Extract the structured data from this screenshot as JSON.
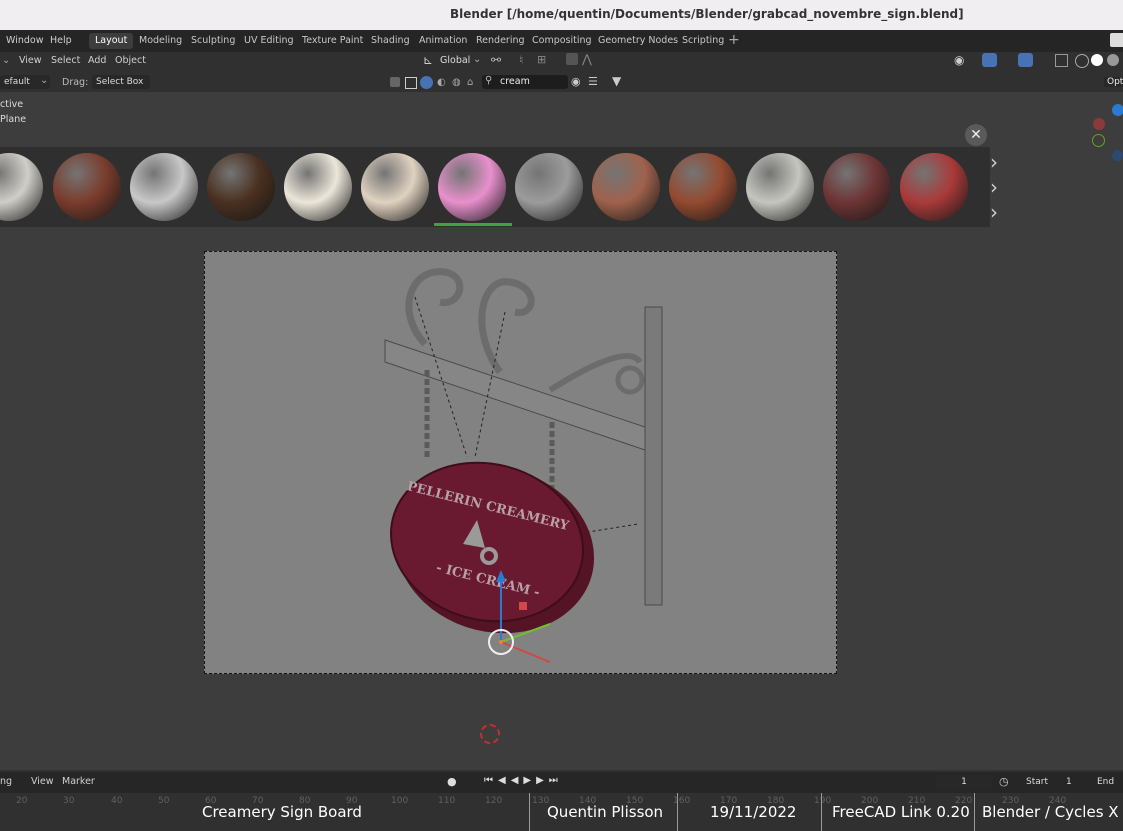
{
  "window": {
    "title": "Blender [/home/quentin/Documents/Blender/grabcad_novembre_sign.blend]"
  },
  "menu": [
    "Window",
    "Help"
  ],
  "workspace_tabs": [
    {
      "label": "Layout",
      "active": true
    },
    {
      "label": "Modeling"
    },
    {
      "label": "Sculpting"
    },
    {
      "label": "UV Editing"
    },
    {
      "label": "Texture Paint"
    },
    {
      "label": "Shading"
    },
    {
      "label": "Animation"
    },
    {
      "label": "Rendering"
    },
    {
      "label": "Compositing"
    },
    {
      "label": "Geometry Nodes"
    },
    {
      "label": "Scripting"
    }
  ],
  "viewport_menu": [
    "View",
    "Select",
    "Add",
    "Object"
  ],
  "orientation": {
    "value": "Global"
  },
  "toolbar": {
    "mode": "efault",
    "drag_label": "Drag:",
    "drag_value": "Select Box",
    "search_value": "cream",
    "options_label": "Opt"
  },
  "overlay_text": {
    "line1": "ctive",
    "line2": "Plane"
  },
  "materials": [
    {
      "icon": "brick-white-material",
      "color": "#d0cec8"
    },
    {
      "icon": "rust-material",
      "color": "#7a3c2c"
    },
    {
      "icon": "stone-material",
      "color": "#c8c8c8"
    },
    {
      "icon": "chocolate-chip-material",
      "color": "#4a3020"
    },
    {
      "icon": "cream-drip-material",
      "color": "#ece6da"
    },
    {
      "icon": "terrazzo-material",
      "color": "#e0d2c0"
    },
    {
      "icon": "pink-cream-material",
      "color": "#e890cc",
      "selected": true
    },
    {
      "icon": "crumpled-foil-material",
      "color": "#9c9c9c"
    },
    {
      "icon": "copper-swirl-material",
      "color": "#a0624c"
    },
    {
      "icon": "glossy-copper-material",
      "color": "#944a30"
    },
    {
      "icon": "white-tile-material",
      "color": "#c6c6c0"
    },
    {
      "icon": "red-fabric-material",
      "color": "#6e3434"
    },
    {
      "icon": "red-quilted-material",
      "color": "#aa3a3a"
    }
  ],
  "scene": {
    "sign_line1": "PELLERIN CREAMERY",
    "sign_line2": "- ICE CREAM -",
    "sign_color": "#6a1a30"
  },
  "timeline": {
    "menu": [
      "ng",
      "View",
      "Marker"
    ],
    "frame": "1",
    "start_label": "Start",
    "start_value": "1",
    "end_label": "End"
  },
  "ruler_ticks": [
    "20",
    "30",
    "40",
    "50",
    "60",
    "70",
    "80",
    "90",
    "100",
    "110",
    "120",
    "130",
    "140",
    "150",
    "160",
    "170",
    "180",
    "190",
    "200",
    "210",
    "220",
    "230",
    "240"
  ],
  "captions": {
    "title": "Creamery Sign Board",
    "author": "Quentin Plisson",
    "date": "19/11/2022",
    "tool": "FreeCAD Link 0.20",
    "renderer": "Blender / Cycles X"
  }
}
